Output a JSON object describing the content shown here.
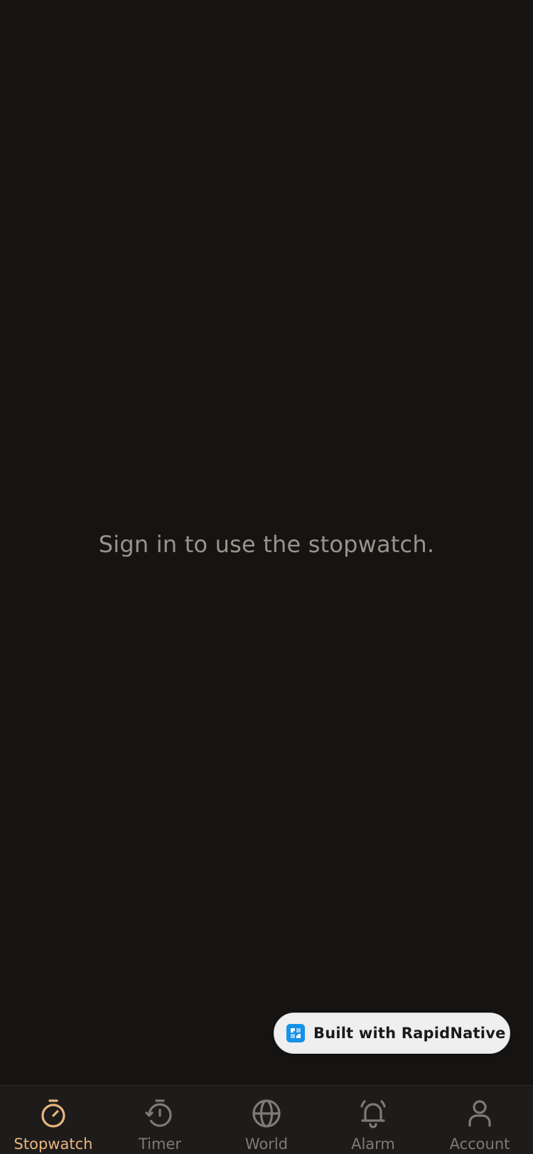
{
  "main": {
    "message": "Sign in to use the stopwatch."
  },
  "badge": {
    "label": "Built with RapidNative",
    "icon": "rapidnative-logo-icon"
  },
  "tabs": [
    {
      "label": "Stopwatch",
      "icon": "stopwatch-icon",
      "active": true
    },
    {
      "label": "Timer",
      "icon": "timer-icon",
      "active": false
    },
    {
      "label": "World",
      "icon": "globe-icon",
      "active": false
    },
    {
      "label": "Alarm",
      "icon": "alarm-bell-icon",
      "active": false
    },
    {
      "label": "Account",
      "icon": "user-icon",
      "active": false
    }
  ],
  "colors": {
    "background": "#151413",
    "tabbar": "#1d1c1b",
    "accent": "#eab57d",
    "inactive": "#7f7a74",
    "message": "#9a938b",
    "badge_bg": "#efefef",
    "badge_logo": "#1592e6"
  }
}
